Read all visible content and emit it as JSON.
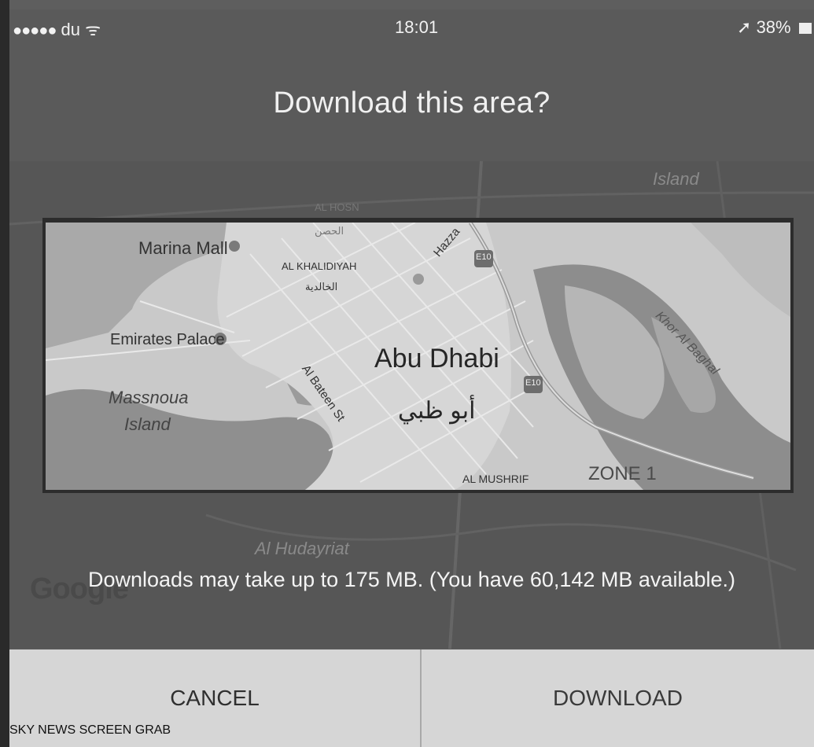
{
  "status_bar": {
    "signal": "●●●●●",
    "carrier": "du",
    "wifi": "ᯤ",
    "time": "18:01",
    "location_arrow": "➚",
    "battery": "38%"
  },
  "dialog": {
    "title": "Download this area?",
    "notice": "Downloads may take up to 175 MB. (You have 60,142 MB available.)"
  },
  "map": {
    "city_name": "Abu Dhabi",
    "city_name_arabic": "أبو ظبي",
    "labels": {
      "marina_mall": "Marina Mall",
      "al_khalidiyah": "AL KHALIDIYAH",
      "al_khalidiyah_arabic": "الخالدية",
      "emirates_palace": "Emirates Palace",
      "massnoua_1": "Massnoua",
      "massnoua_2": "Island",
      "al_bateen_st": "Al Bateen St",
      "hazza": "Hazza",
      "khor_al_baghal": "Khor Al Baghal",
      "al_mushrif": "AL MUSHRIF",
      "zone_1": "ZONE 1",
      "e10_top": "E10",
      "e10_mid": "E10",
      "al_hosn": "AL HOSN",
      "al_hosn_arabic": "الحصن"
    },
    "outer_labels": {
      "island": "Island",
      "al_hudayriat": "Al Hudayriat"
    },
    "attribution": "Google"
  },
  "buttons": {
    "cancel": "CANCEL",
    "download": "DOWNLOAD"
  },
  "credit": "SKY NEWS SCREEN GRAB"
}
